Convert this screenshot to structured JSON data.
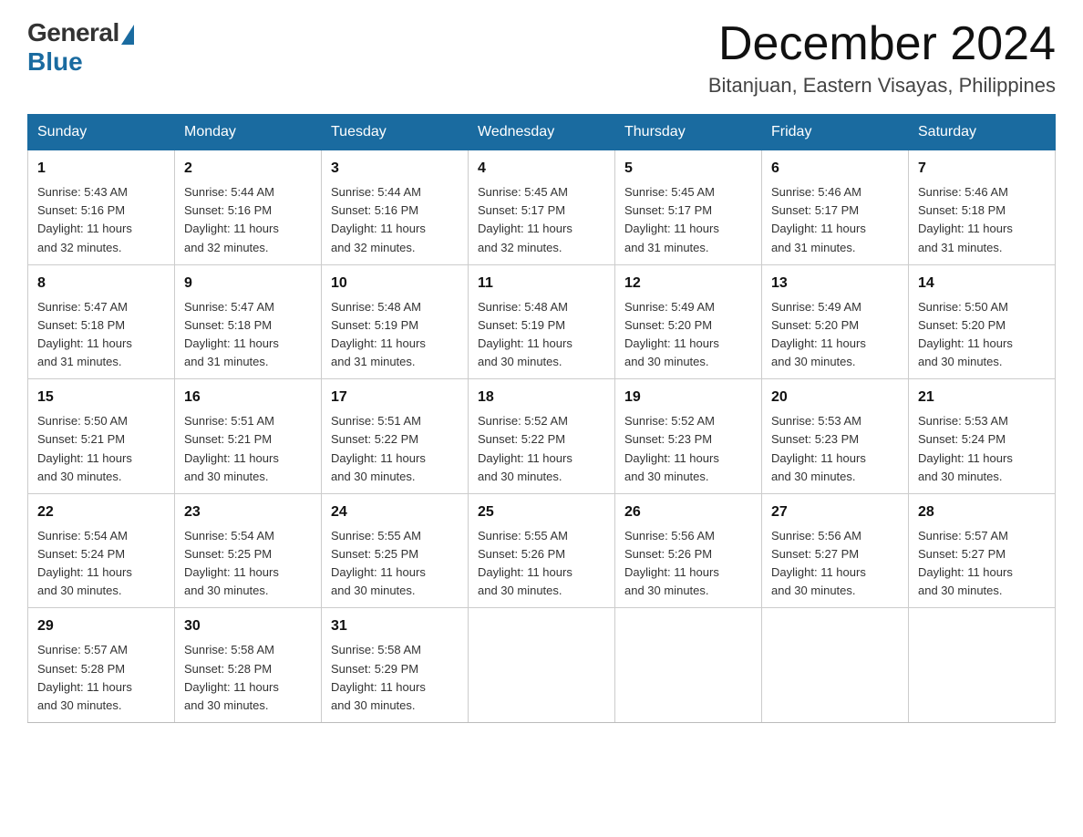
{
  "header": {
    "logo_general": "General",
    "logo_blue": "Blue",
    "month_title": "December 2024",
    "location": "Bitanjuan, Eastern Visayas, Philippines"
  },
  "weekdays": [
    "Sunday",
    "Monday",
    "Tuesday",
    "Wednesday",
    "Thursday",
    "Friday",
    "Saturday"
  ],
  "weeks": [
    [
      {
        "day": "1",
        "sunrise": "5:43 AM",
        "sunset": "5:16 PM",
        "daylight": "11 hours and 32 minutes."
      },
      {
        "day": "2",
        "sunrise": "5:44 AM",
        "sunset": "5:16 PM",
        "daylight": "11 hours and 32 minutes."
      },
      {
        "day": "3",
        "sunrise": "5:44 AM",
        "sunset": "5:16 PM",
        "daylight": "11 hours and 32 minutes."
      },
      {
        "day": "4",
        "sunrise": "5:45 AM",
        "sunset": "5:17 PM",
        "daylight": "11 hours and 32 minutes."
      },
      {
        "day": "5",
        "sunrise": "5:45 AM",
        "sunset": "5:17 PM",
        "daylight": "11 hours and 31 minutes."
      },
      {
        "day": "6",
        "sunrise": "5:46 AM",
        "sunset": "5:17 PM",
        "daylight": "11 hours and 31 minutes."
      },
      {
        "day": "7",
        "sunrise": "5:46 AM",
        "sunset": "5:18 PM",
        "daylight": "11 hours and 31 minutes."
      }
    ],
    [
      {
        "day": "8",
        "sunrise": "5:47 AM",
        "sunset": "5:18 PM",
        "daylight": "11 hours and 31 minutes."
      },
      {
        "day": "9",
        "sunrise": "5:47 AM",
        "sunset": "5:18 PM",
        "daylight": "11 hours and 31 minutes."
      },
      {
        "day": "10",
        "sunrise": "5:48 AM",
        "sunset": "5:19 PM",
        "daylight": "11 hours and 31 minutes."
      },
      {
        "day": "11",
        "sunrise": "5:48 AM",
        "sunset": "5:19 PM",
        "daylight": "11 hours and 30 minutes."
      },
      {
        "day": "12",
        "sunrise": "5:49 AM",
        "sunset": "5:20 PM",
        "daylight": "11 hours and 30 minutes."
      },
      {
        "day": "13",
        "sunrise": "5:49 AM",
        "sunset": "5:20 PM",
        "daylight": "11 hours and 30 minutes."
      },
      {
        "day": "14",
        "sunrise": "5:50 AM",
        "sunset": "5:20 PM",
        "daylight": "11 hours and 30 minutes."
      }
    ],
    [
      {
        "day": "15",
        "sunrise": "5:50 AM",
        "sunset": "5:21 PM",
        "daylight": "11 hours and 30 minutes."
      },
      {
        "day": "16",
        "sunrise": "5:51 AM",
        "sunset": "5:21 PM",
        "daylight": "11 hours and 30 minutes."
      },
      {
        "day": "17",
        "sunrise": "5:51 AM",
        "sunset": "5:22 PM",
        "daylight": "11 hours and 30 minutes."
      },
      {
        "day": "18",
        "sunrise": "5:52 AM",
        "sunset": "5:22 PM",
        "daylight": "11 hours and 30 minutes."
      },
      {
        "day": "19",
        "sunrise": "5:52 AM",
        "sunset": "5:23 PM",
        "daylight": "11 hours and 30 minutes."
      },
      {
        "day": "20",
        "sunrise": "5:53 AM",
        "sunset": "5:23 PM",
        "daylight": "11 hours and 30 minutes."
      },
      {
        "day": "21",
        "sunrise": "5:53 AM",
        "sunset": "5:24 PM",
        "daylight": "11 hours and 30 minutes."
      }
    ],
    [
      {
        "day": "22",
        "sunrise": "5:54 AM",
        "sunset": "5:24 PM",
        "daylight": "11 hours and 30 minutes."
      },
      {
        "day": "23",
        "sunrise": "5:54 AM",
        "sunset": "5:25 PM",
        "daylight": "11 hours and 30 minutes."
      },
      {
        "day": "24",
        "sunrise": "5:55 AM",
        "sunset": "5:25 PM",
        "daylight": "11 hours and 30 minutes."
      },
      {
        "day": "25",
        "sunrise": "5:55 AM",
        "sunset": "5:26 PM",
        "daylight": "11 hours and 30 minutes."
      },
      {
        "day": "26",
        "sunrise": "5:56 AM",
        "sunset": "5:26 PM",
        "daylight": "11 hours and 30 minutes."
      },
      {
        "day": "27",
        "sunrise": "5:56 AM",
        "sunset": "5:27 PM",
        "daylight": "11 hours and 30 minutes."
      },
      {
        "day": "28",
        "sunrise": "5:57 AM",
        "sunset": "5:27 PM",
        "daylight": "11 hours and 30 minutes."
      }
    ],
    [
      {
        "day": "29",
        "sunrise": "5:57 AM",
        "sunset": "5:28 PM",
        "daylight": "11 hours and 30 minutes."
      },
      {
        "day": "30",
        "sunrise": "5:58 AM",
        "sunset": "5:28 PM",
        "daylight": "11 hours and 30 minutes."
      },
      {
        "day": "31",
        "sunrise": "5:58 AM",
        "sunset": "5:29 PM",
        "daylight": "11 hours and 30 minutes."
      },
      null,
      null,
      null,
      null
    ]
  ],
  "labels": {
    "sunrise": "Sunrise:",
    "sunset": "Sunset:",
    "daylight": "Daylight:"
  }
}
